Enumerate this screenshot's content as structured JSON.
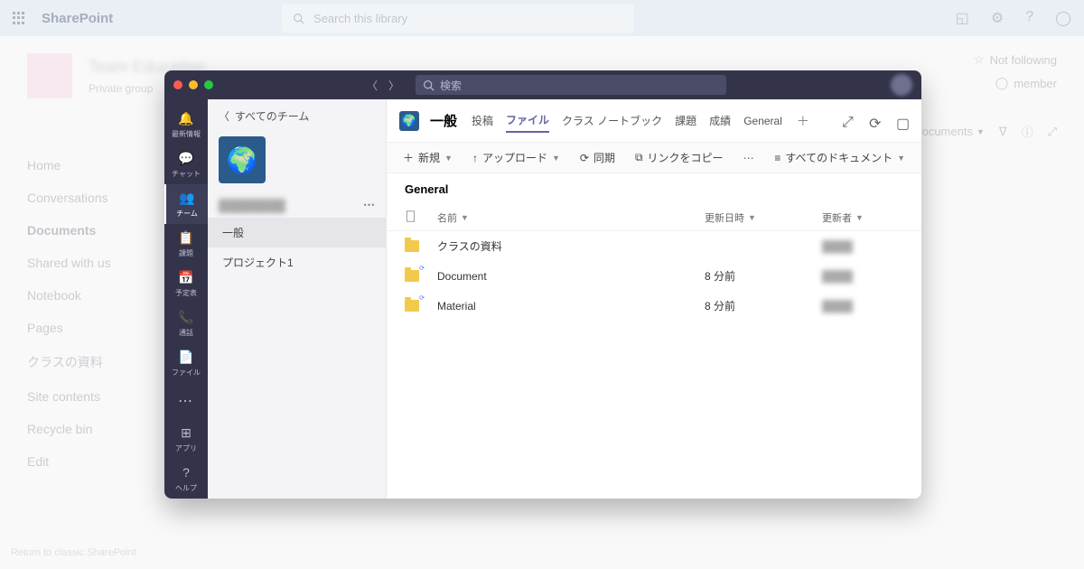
{
  "sharepoint": {
    "brand": "SharePoint",
    "search_placeholder": "Search this library",
    "site_name": "Team Education",
    "private": "Private group",
    "not_following": "Not following",
    "member": "member",
    "documents_dd": "documents",
    "nav": [
      "Home",
      "Conversations",
      "Documents",
      "Shared with us",
      "Notebook",
      "Pages",
      "クラスの資料",
      "Site contents",
      "Recycle bin",
      "Edit"
    ],
    "nav_active_index": 2,
    "footer": "Return to classic SharePoint"
  },
  "teams": {
    "search_placeholder": "検索",
    "rail": [
      {
        "label": "最新情報",
        "icon": "bell"
      },
      {
        "label": "チャット",
        "icon": "chat"
      },
      {
        "label": "チーム",
        "icon": "teams",
        "active": true
      },
      {
        "label": "課題",
        "icon": "assign"
      },
      {
        "label": "予定表",
        "icon": "calendar"
      },
      {
        "label": "通話",
        "icon": "call"
      },
      {
        "label": "ファイル",
        "icon": "file"
      }
    ],
    "rail_bottom": [
      {
        "label": "アプリ",
        "icon": "apps"
      },
      {
        "label": "ヘルプ",
        "icon": "help"
      }
    ],
    "back_label": "すべてのチーム",
    "team_name": "████████",
    "channels": [
      {
        "name": "一般",
        "active": true
      },
      {
        "name": "プロジェクト1"
      }
    ],
    "channel_header": {
      "title": "一般",
      "tabs": [
        "投稿",
        "ファイル",
        "クラス ノートブック",
        "課題",
        "成績",
        "General"
      ],
      "active_tab_index": 1
    },
    "file_cmds": {
      "new": "新規",
      "upload": "アップロード",
      "sync": "同期",
      "copylink": "リンクをコピー",
      "alldocs": "すべてのドキュメント"
    },
    "breadcrumb": "General",
    "columns": {
      "name": "名前",
      "modified": "更新日時",
      "modifiedby": "更新者"
    },
    "files": [
      {
        "name": "クラスの資料",
        "modified": "",
        "modifiedby": "████",
        "synced": false
      },
      {
        "name": "Document",
        "modified": "8 分前",
        "modifiedby": "████",
        "synced": true
      },
      {
        "name": "Material",
        "modified": "8 分前",
        "modifiedby": "████",
        "synced": true
      }
    ]
  }
}
